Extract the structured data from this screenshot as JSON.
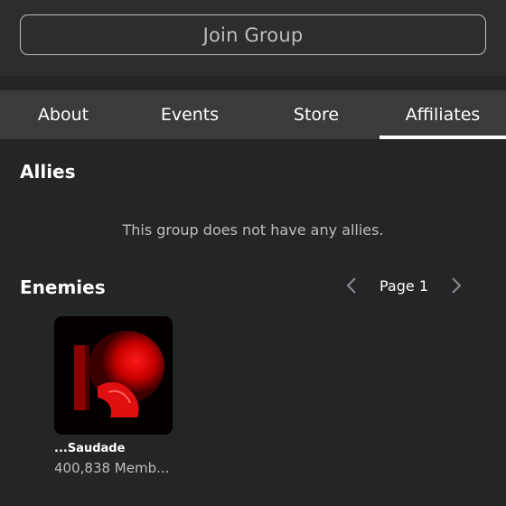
{
  "header": {
    "join_label": "Join Group"
  },
  "tabs": [
    {
      "label": "About"
    },
    {
      "label": "Events"
    },
    {
      "label": "Store"
    },
    {
      "label": "Affiliates",
      "active": true
    }
  ],
  "allies": {
    "title": "Allies",
    "empty_message": "This group does not have any allies."
  },
  "enemies": {
    "title": "Enemies",
    "page_label": "Page 1",
    "groups": [
      {
        "name": "...Saudade",
        "members": "400,838 Memb..."
      }
    ]
  },
  "colors": {
    "background": "#232527",
    "top_bar": "#2b2d2f",
    "tab_bar": "#393b3d",
    "muted_text": "#bdbebe",
    "accent_red": "#d40000"
  }
}
